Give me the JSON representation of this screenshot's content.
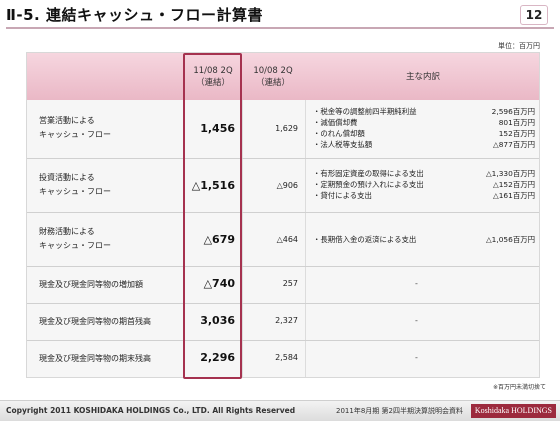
{
  "page": {
    "title": "Ⅱ-5. 連結キャッシュ・フロー計算書",
    "page_number": "12",
    "unit_note": "単位：百万円",
    "footnote": "※百万円未満切捨て"
  },
  "table": {
    "headers": {
      "col1_line1": "11/08 2Q",
      "col1_line2": "（連結）",
      "col2_line1": "10/08 2Q",
      "col2_line2": "（連結）",
      "col3": "主な内訳"
    },
    "rows": [
      {
        "label_line1": "営業活動による",
        "label_line2": "キャッシュ・フロー",
        "current": "1,456",
        "previous": "1,629",
        "details": [
          {
            "item": "・税金等の調整前四半期純利益",
            "amount": "2,596百万円"
          },
          {
            "item": "・減価償却費",
            "amount": "801百万円"
          },
          {
            "item": "・のれん償却額",
            "amount": "152百万円"
          },
          {
            "item": "・法人税等支払額",
            "amount": "△877百万円"
          }
        ]
      },
      {
        "label_line1": "投資活動による",
        "label_line2": "キャッシュ・フロー",
        "current": "△1,516",
        "previous": "△906",
        "details": [
          {
            "item": "・有形固定資産の取得による支出",
            "amount": "△1,330百万円"
          },
          {
            "item": "・定期預金の預け入れによる支出",
            "amount": "△152百万円"
          },
          {
            "item": "・貸付による支出",
            "amount": "△161百万円"
          }
        ]
      },
      {
        "label_line1": "財務活動による",
        "label_line2": "キャッシュ・フロー",
        "current": "△679",
        "previous": "△464",
        "details": [
          {
            "item": "・長期借入金の返済による支出",
            "amount": "△1,056百万円"
          }
        ]
      },
      {
        "label_line1": "現金及び現金同等物の増加額",
        "label_line2": "",
        "current": "△740",
        "previous": "257",
        "dash": "-"
      },
      {
        "label_line1": "現金及び現金同等物の期首残高",
        "label_line2": "",
        "current": "3,036",
        "previous": "2,327",
        "dash": "-"
      },
      {
        "label_line1": "現金及び現金同等物の期末残高",
        "label_line2": "",
        "current": "2,296",
        "previous": "2,584",
        "dash": "-"
      }
    ]
  },
  "footer": {
    "copyright": "Copyright 2011 KOSHIDAKA HOLDINGS Co., LTD. All Rights Reserved",
    "meeting": "2011年8月期 第2四半期決算説明会資料",
    "logo_main": "Koshidaka",
    "logo_sub": "HOLDINGS"
  },
  "colors": {
    "highlight_border": "#a5324f",
    "header_pink": "#eab8c6",
    "logo_bg": "#9c2a3d"
  }
}
